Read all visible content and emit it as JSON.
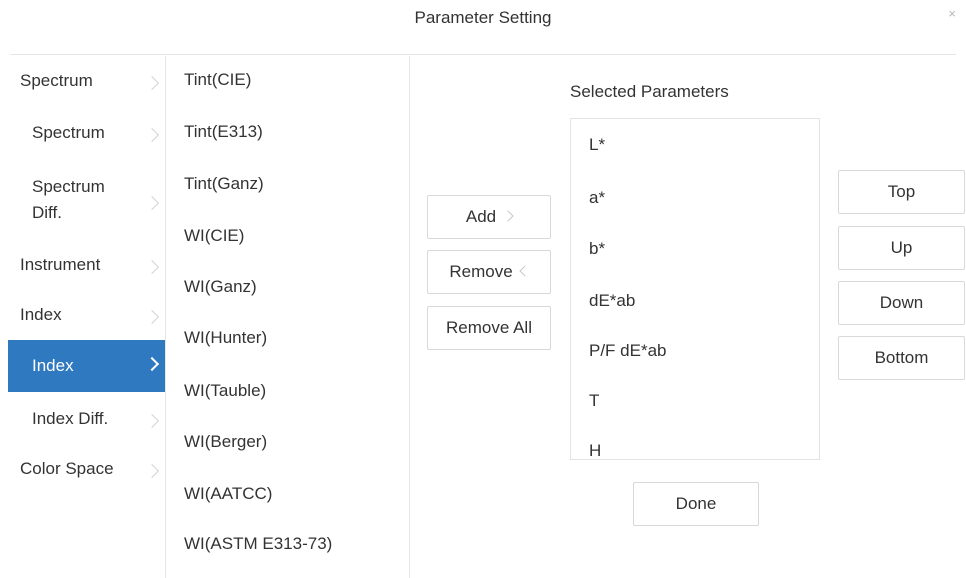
{
  "dialog": {
    "title": "Parameter Setting",
    "close_glyph": "×"
  },
  "categories": [
    {
      "label": "Spectrum"
    },
    {
      "label": "Spectrum"
    },
    {
      "label": "Spectrum Diff."
    },
    {
      "label": "Instrument"
    },
    {
      "label": "Index"
    },
    {
      "label": "Index",
      "selected": true
    },
    {
      "label": "Index Diff."
    },
    {
      "label": "Color Space"
    }
  ],
  "parameters": [
    "Tint(CIE)",
    "Tint(E313)",
    "Tint(Ganz)",
    "WI(CIE)",
    "WI(Ganz)",
    "WI(Hunter)",
    "WI(Tauble)",
    "WI(Berger)",
    "WI(AATCC)",
    "WI(ASTM E313-73)"
  ],
  "transfer_buttons": {
    "add": "Add",
    "remove": "Remove",
    "remove_all": "Remove All"
  },
  "selected": {
    "title": "Selected Parameters",
    "items": [
      "L*",
      "a*",
      "b*",
      "dE*ab",
      "P/F dE*ab",
      "T",
      "H"
    ]
  },
  "order_buttons": {
    "top": "Top",
    "up": "Up",
    "down": "Down",
    "bottom": "Bottom"
  },
  "done_label": "Done",
  "colors": {
    "accent": "#2f79c0",
    "border": "#d9d9d9",
    "text": "#333333"
  }
}
